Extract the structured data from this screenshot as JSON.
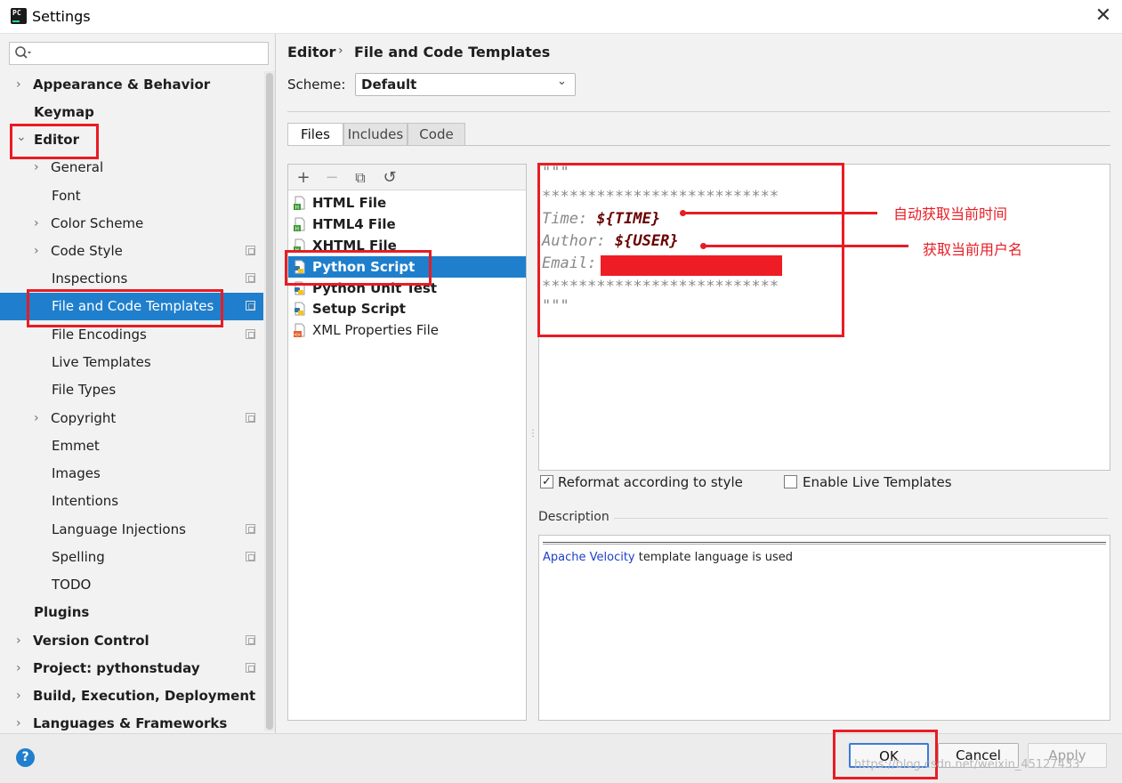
{
  "window": {
    "title": "Settings",
    "close_glyph": "✕"
  },
  "search": {
    "placeholder": ""
  },
  "sidebar": {
    "items": [
      {
        "label": "Appearance & Behavior",
        "arrow": "›"
      },
      {
        "label": "Keymap"
      },
      {
        "label": "Editor",
        "arrow": "⌄"
      },
      {
        "label": "General",
        "arrow": "›"
      },
      {
        "label": "Font"
      },
      {
        "label": "Color Scheme",
        "arrow": "›"
      },
      {
        "label": "Code Style",
        "arrow": "›"
      },
      {
        "label": "Inspections"
      },
      {
        "label": "File and Code Templates"
      },
      {
        "label": "File Encodings"
      },
      {
        "label": "Live Templates"
      },
      {
        "label": "File Types"
      },
      {
        "label": "Copyright",
        "arrow": "›"
      },
      {
        "label": "Emmet"
      },
      {
        "label": "Images"
      },
      {
        "label": "Intentions"
      },
      {
        "label": "Language Injections"
      },
      {
        "label": "Spelling"
      },
      {
        "label": "TODO"
      },
      {
        "label": "Plugins"
      },
      {
        "label": "Version Control",
        "arrow": "›"
      },
      {
        "label": "Project: pythonstuday",
        "arrow": "›"
      },
      {
        "label": "Build, Execution, Deployment",
        "arrow": "›"
      },
      {
        "label": "Languages & Frameworks",
        "arrow": "›"
      }
    ]
  },
  "header": {
    "breadcrumb": [
      "Editor",
      "File and Code Templates"
    ],
    "breadcrumb_sep": "›",
    "scheme_label": "Scheme:",
    "scheme_value": "Default",
    "scheme_chevron": "⌄"
  },
  "tabs": [
    {
      "label": "Files"
    },
    {
      "label": "Includes"
    },
    {
      "label": "Code"
    }
  ],
  "list_toolbar": {
    "add": "+",
    "remove": "−",
    "copy": "⧉",
    "reset": "↺"
  },
  "templates": [
    {
      "label": "HTML File",
      "icon": "html-file-icon"
    },
    {
      "label": "HTML4 File",
      "icon": "html-file-icon"
    },
    {
      "label": "XHTML File",
      "icon": "html-file-icon"
    },
    {
      "label": "Python Script",
      "icon": "python-file-icon"
    },
    {
      "label": "Python Unit Test",
      "icon": "python-file-icon"
    },
    {
      "label": "Setup Script",
      "icon": "python-file-icon"
    },
    {
      "label": "XML Properties File",
      "icon": "xml-file-icon"
    }
  ],
  "editor": {
    "lines": {
      "quote_open": "\"\"\"",
      "stars_top": "**************************",
      "time_key": "Time: ",
      "time_var": "${TIME}",
      "author_key": "Author: ",
      "author_var": "${USER}",
      "email_key": "Email:",
      "stars_bottom": "**************************",
      "quote_close": "\"\"\""
    }
  },
  "annotations": {
    "time_note": "自动获取当前时间",
    "user_note": "获取当前用户名"
  },
  "options": {
    "reformat": {
      "label": "Reformat according to style",
      "checked": "✓"
    },
    "live_templates": {
      "label": "Enable Live Templates",
      "checked": ""
    }
  },
  "description": {
    "label": "Description",
    "link": "Apache Velocity",
    "text": " template language is used"
  },
  "footer": {
    "help": "?",
    "ok": "OK",
    "cancel": "Cancel",
    "apply": "Apply",
    "watermark": "https://blog.csdn.net/weixin_45127433"
  },
  "colors": {
    "selection": "#1f7fcc",
    "annotation_red": "#e81c24",
    "template_var": "#6a0000",
    "link": "#1d3fc9"
  }
}
